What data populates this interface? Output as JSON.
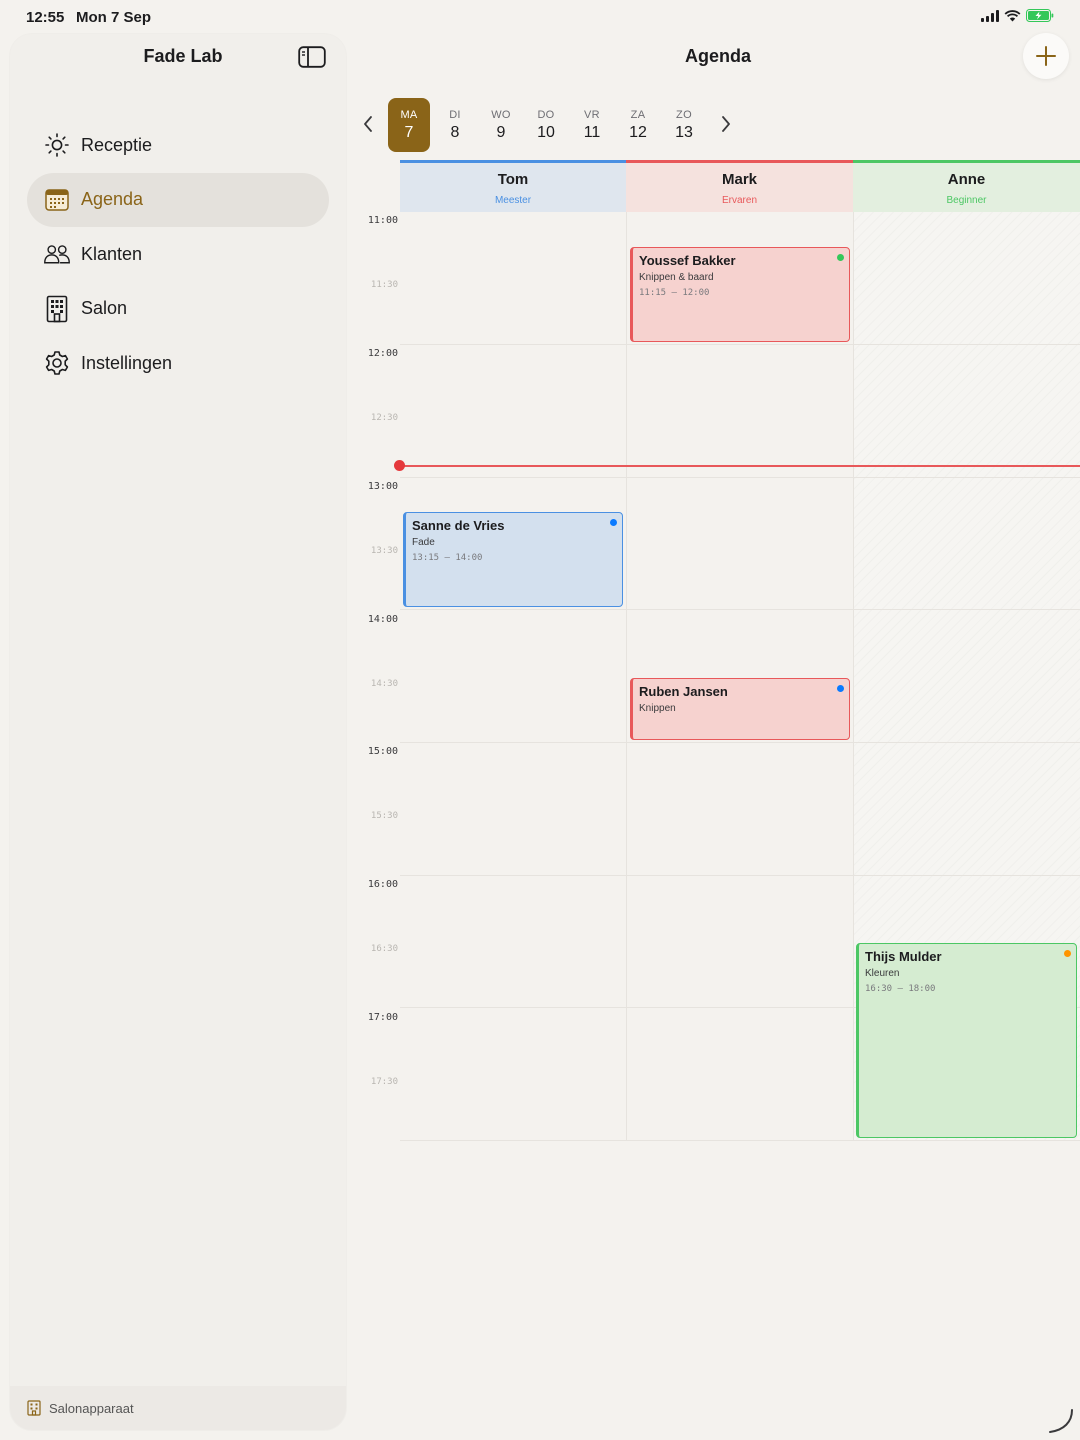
{
  "status": {
    "time": "12:55",
    "date": "Mon 7 Sep"
  },
  "sidebar": {
    "title": "Fade Lab",
    "items": [
      {
        "label": "Receptie",
        "icon": "sun-icon"
      },
      {
        "label": "Agenda",
        "icon": "calendar-icon",
        "active": true
      },
      {
        "label": "Klanten",
        "icon": "people-icon"
      },
      {
        "label": "Salon",
        "icon": "building-icon"
      },
      {
        "label": "Instellingen",
        "icon": "gear-icon"
      }
    ],
    "footer": "Salonapparaat"
  },
  "header": {
    "title": "Agenda"
  },
  "week": {
    "days": [
      {
        "name": "MA",
        "num": "7",
        "active": true
      },
      {
        "name": "DI",
        "num": "8"
      },
      {
        "name": "WO",
        "num": "9"
      },
      {
        "name": "DO",
        "num": "10"
      },
      {
        "name": "VR",
        "num": "11"
      },
      {
        "name": "ZA",
        "num": "12"
      },
      {
        "name": "ZO",
        "num": "13"
      }
    ]
  },
  "staff": [
    {
      "name": "Tom",
      "role": "Meester",
      "color": "#4a90e2"
    },
    {
      "name": "Mark",
      "role": "Ervaren",
      "color": "#e8585a"
    },
    {
      "name": "Anne",
      "role": "Beginner",
      "color": "#4cc764"
    }
  ],
  "times": [
    "11:00",
    "11:30",
    "12:00",
    "12:30",
    "13:00",
    "13:30",
    "14:00",
    "14:30",
    "15:00",
    "15:30",
    "16:00",
    "16:30",
    "17:00",
    "17:30"
  ],
  "appointments": [
    {
      "name": "Youssef Bakker",
      "service": "Knippen & baard",
      "time": "11:15 – 12:00",
      "dot": "#34c759"
    },
    {
      "name": "Sanne de Vries",
      "service": "Fade",
      "time": "13:15 – 14:00",
      "dot": "#0a7aff"
    },
    {
      "name": "Ruben Jansen",
      "service": "Knippen",
      "time": "",
      "dot": "#0a7aff"
    },
    {
      "name": "Thijs Mulder",
      "service": "Kleuren",
      "time": "16:30 – 18:00",
      "dot": "#ff9500"
    }
  ]
}
